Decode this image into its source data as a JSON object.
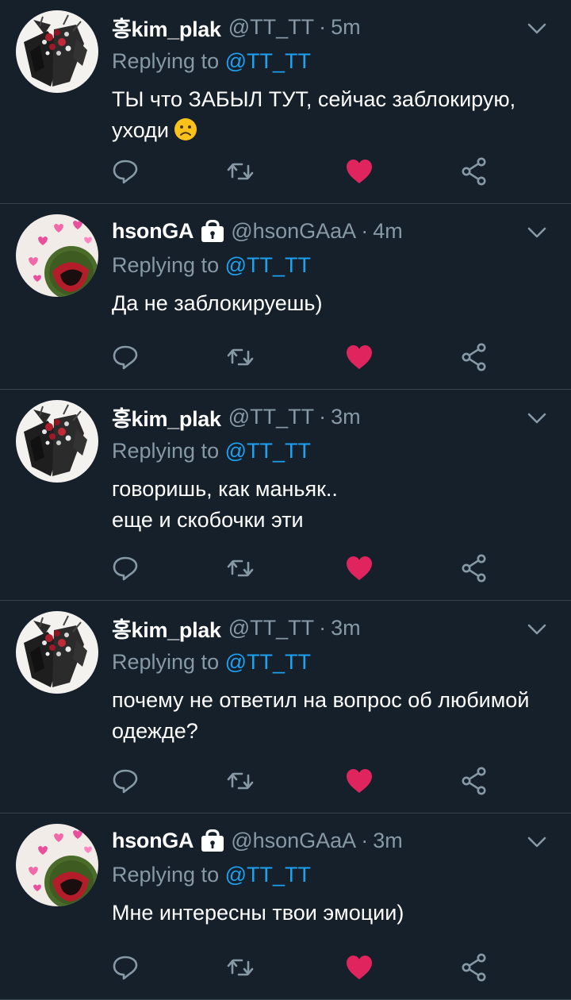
{
  "tweets": [
    {
      "name": "홍kim_plak",
      "handle": "@TT_TT",
      "time": "5m",
      "locked": false,
      "avatar": "bouquet",
      "replying_prefix": "Replying to ",
      "replying_to": "@TT_TT",
      "lines": [
        "ТЫ что ЗАБЫЛ ТУТ, сейчас заблокирую,",
        "уходи"
      ],
      "emoji": "frowning-face",
      "liked": true
    },
    {
      "name": "hsonGA",
      "handle": "@hsonGAaA",
      "time": "4m",
      "locked": true,
      "avatar": "hearts",
      "replying_prefix": "Replying to ",
      "replying_to": "@TT_TT",
      "lines": [
        "Да не заблокируешь)"
      ],
      "liked": true
    },
    {
      "name": "홍kim_plak",
      "handle": "@TT_TT",
      "time": "3m",
      "locked": false,
      "avatar": "bouquet",
      "replying_prefix": "Replying to ",
      "replying_to": "@TT_TT",
      "lines": [
        "говоришь, как маньяк..",
        "еще и скобочки эти"
      ],
      "liked": true
    },
    {
      "name": "홍kim_plak",
      "handle": "@TT_TT",
      "time": "3m",
      "locked": false,
      "avatar": "bouquet",
      "replying_prefix": "Replying to ",
      "replying_to": "@TT_TT",
      "lines": [
        "почему не ответил на вопрос об любимой",
        "одежде?"
      ],
      "liked": true
    },
    {
      "name": "hsonGA",
      "handle": "@hsonGAaA",
      "time": "3m",
      "locked": true,
      "avatar": "hearts",
      "replying_prefix": "Replying to ",
      "replying_to": "@TT_TT",
      "lines": [
        "Мне интересны твои эмоции)"
      ],
      "liked": true
    }
  ],
  "actions": [
    "reply-icon",
    "retweet-icon",
    "like-icon",
    "share-icon"
  ],
  "colors": {
    "background": "#15202b",
    "divider": "#38444d",
    "secondary_text": "#8899a6",
    "mention": "#1da1f2",
    "like": "#e0245e"
  }
}
